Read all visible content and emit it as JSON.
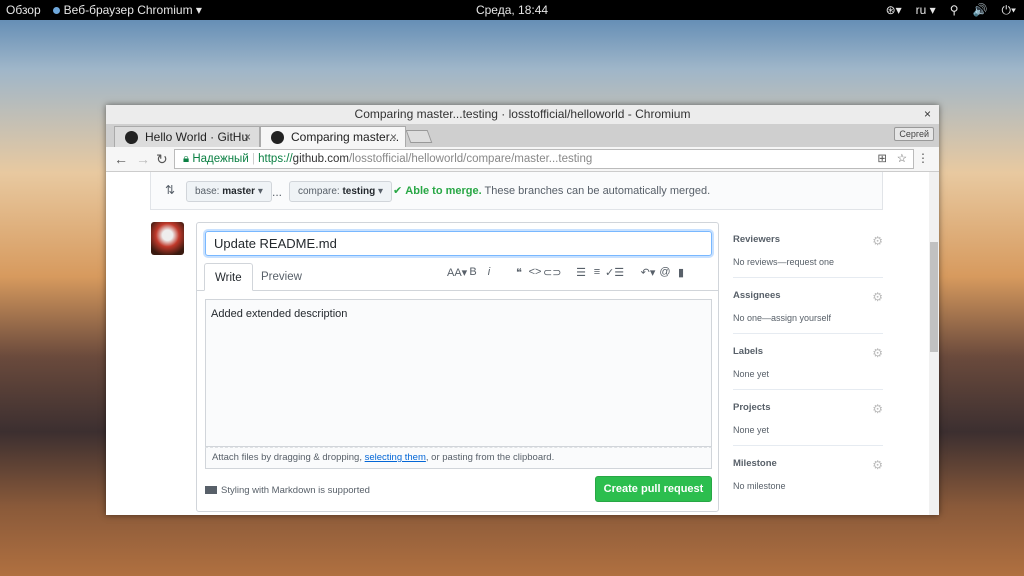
{
  "system_bar": {
    "activities": "Обзор",
    "app_menu": "Веб-браузер Chromium ▾",
    "clock": "Среда, 18:44",
    "lang": "ru ▾",
    "icons": [
      "accessibility-icon",
      "network-icon",
      "volume-icon",
      "power-icon"
    ]
  },
  "window": {
    "title": "Comparing master...testing · losstofficial/helloworld - Chromium",
    "close": "×"
  },
  "tabs": [
    {
      "label": "Hello World · GitHu",
      "close": "×"
    },
    {
      "label": "Comparing master...",
      "close": "×"
    }
  ],
  "profile_button": "Сергей",
  "address": {
    "secure_label": "Надежный",
    "scheme": "https://",
    "host": "github.com",
    "path": "/losstofficial/helloworld/compare/master...testing"
  },
  "merge_bar": {
    "base_prefix": "base:",
    "base": "master",
    "ellipsis": "...",
    "compare_prefix": "compare:",
    "compare": "testing",
    "status": "Able to merge.",
    "status_detail": "These branches can be automatically merged.",
    "status_color": "#28a745"
  },
  "form": {
    "title_value": "Update README.md",
    "tab_write": "Write",
    "tab_preview": "Preview",
    "body": "Added extended description",
    "attach_pre": "Attach files by dragging & dropping, ",
    "attach_link": "selecting them",
    "attach_post": ", or pasting from the clipboard.",
    "markdown_note": "Styling with Markdown is supported",
    "submit": "Create pull request"
  },
  "toolbar": [
    "AA▾",
    "B",
    "i",
    "❝",
    "<>",
    "⊂⊃",
    "☰",
    "≡",
    "✓☰",
    "↶▾",
    "@",
    "▮"
  ],
  "sidebar": [
    {
      "title": "Reviewers",
      "value": "No reviews—request one"
    },
    {
      "title": "Assignees",
      "value": "No one—assign yourself"
    },
    {
      "title": "Labels",
      "value": "None yet"
    },
    {
      "title": "Projects",
      "value": "None yet"
    },
    {
      "title": "Milestone",
      "value": "No milestone"
    }
  ]
}
